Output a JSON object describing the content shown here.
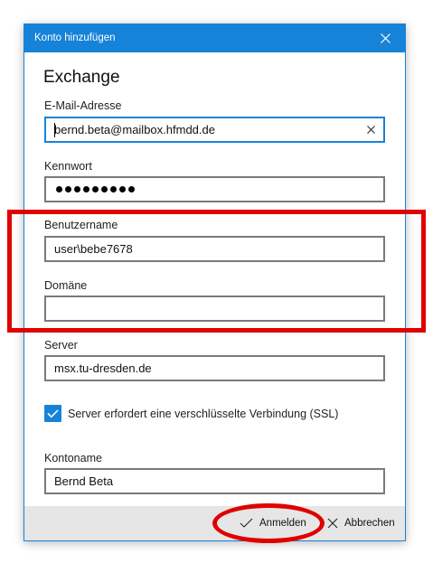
{
  "window": {
    "title": "Konto hinzufügen",
    "close_icon": "close-icon"
  },
  "heading": "Exchange",
  "fields": {
    "email": {
      "label": "E-Mail-Adresse",
      "value": "bernd.beta@mailbox.hfmdd.de"
    },
    "password": {
      "label": "Kennwort",
      "masked_chars": 9
    },
    "username": {
      "label": "Benutzername",
      "value": "user\\bebe7678"
    },
    "domain": {
      "label": "Domäne",
      "value": ""
    },
    "server": {
      "label": "Server",
      "value": "msx.tu-dresden.de"
    },
    "account_name": {
      "label": "Kontoname",
      "value": "Bernd Beta"
    }
  },
  "ssl": {
    "label": "Server erfordert eine verschlüsselte Verbindung (SSL)",
    "checked": true
  },
  "footer": {
    "signin_label": "Anmelden",
    "cancel_label": "Abbrechen"
  },
  "colors": {
    "accent": "#1683d8",
    "annotation": "#e00000"
  }
}
